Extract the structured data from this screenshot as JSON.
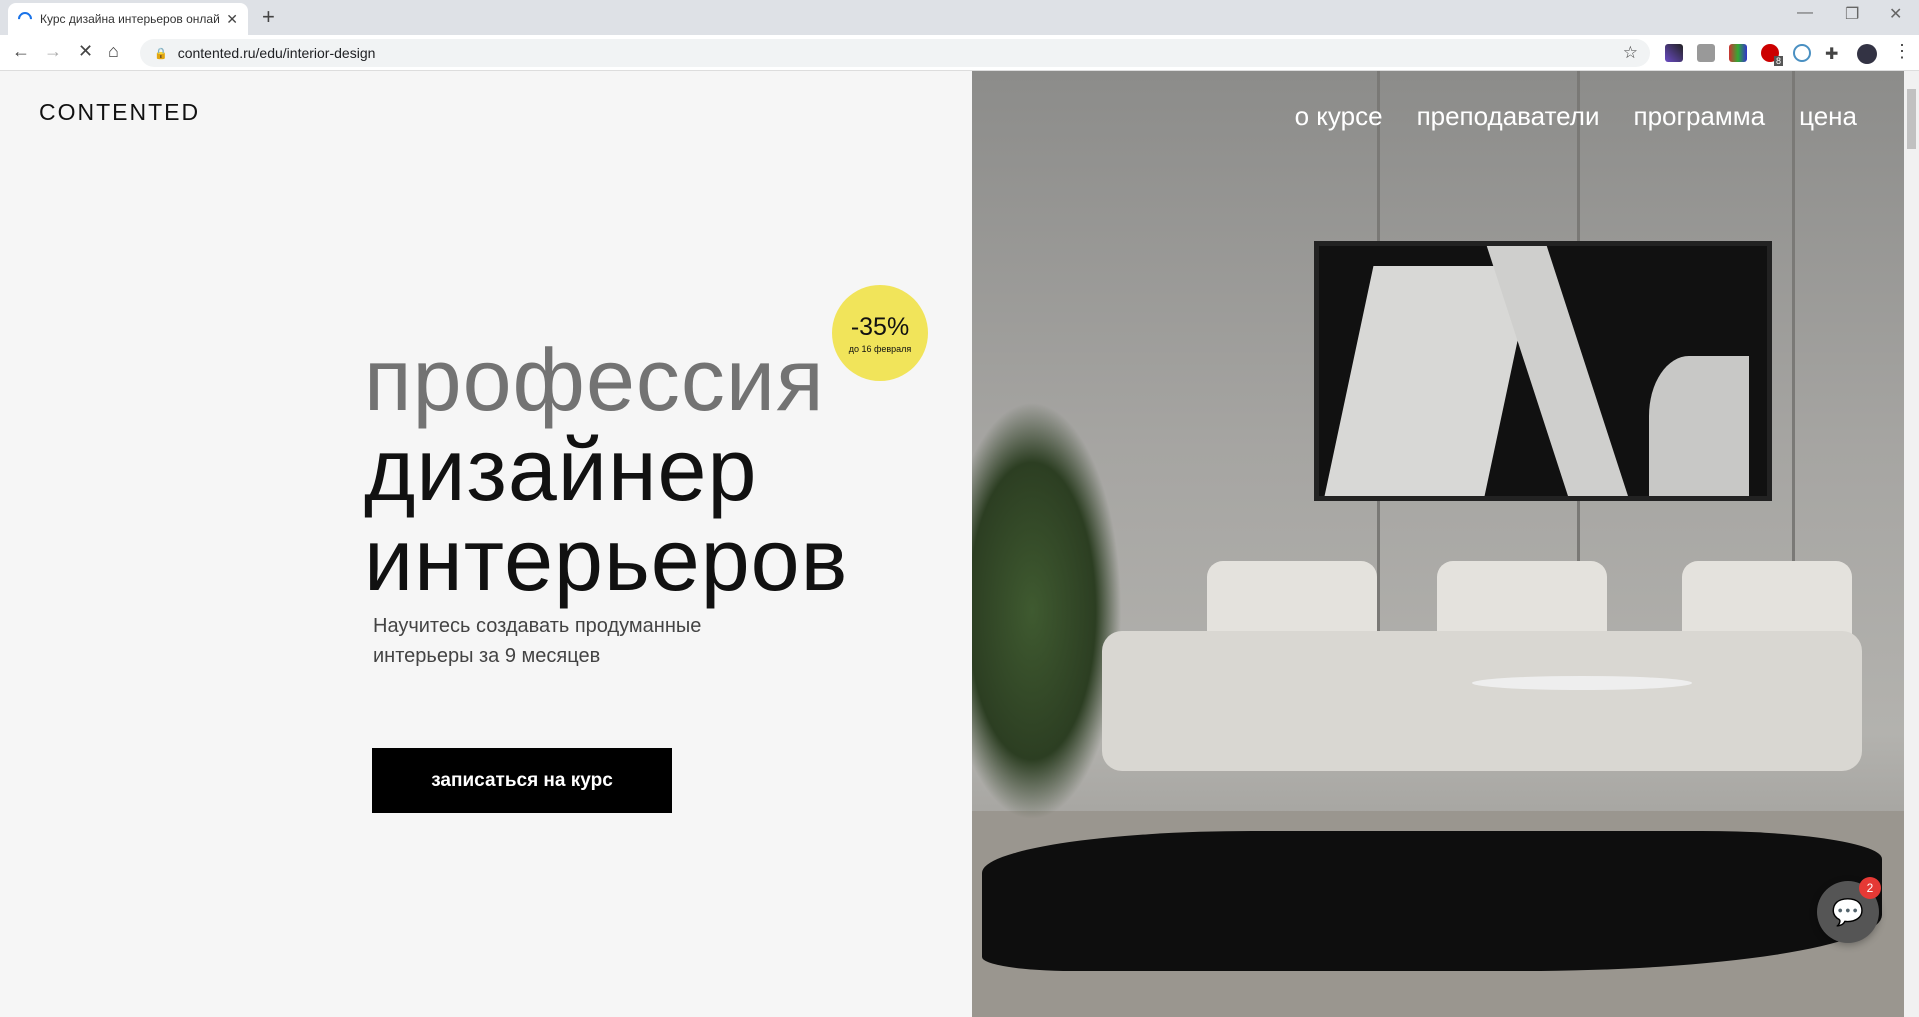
{
  "browser": {
    "tab_title": "Курс дизайна интерьеров онлайн",
    "url": "contented.ru/edu/interior-design",
    "extension_badge": "8"
  },
  "site": {
    "logo": "CONTENTED",
    "nav": [
      "о курсе",
      "преподаватели",
      "программа",
      "цена"
    ],
    "headline": [
      "профессия",
      "дизайнер",
      "интерьеров"
    ],
    "subtitle_lines": [
      "Научитесь создавать продуманные",
      "интерьеры за 9 месяцев"
    ],
    "cta": "записаться на курс",
    "badge": {
      "discount": "-35%",
      "until": "до 16 февраля",
      "color": "#f1e45a"
    },
    "chat": {
      "count": "2"
    }
  }
}
